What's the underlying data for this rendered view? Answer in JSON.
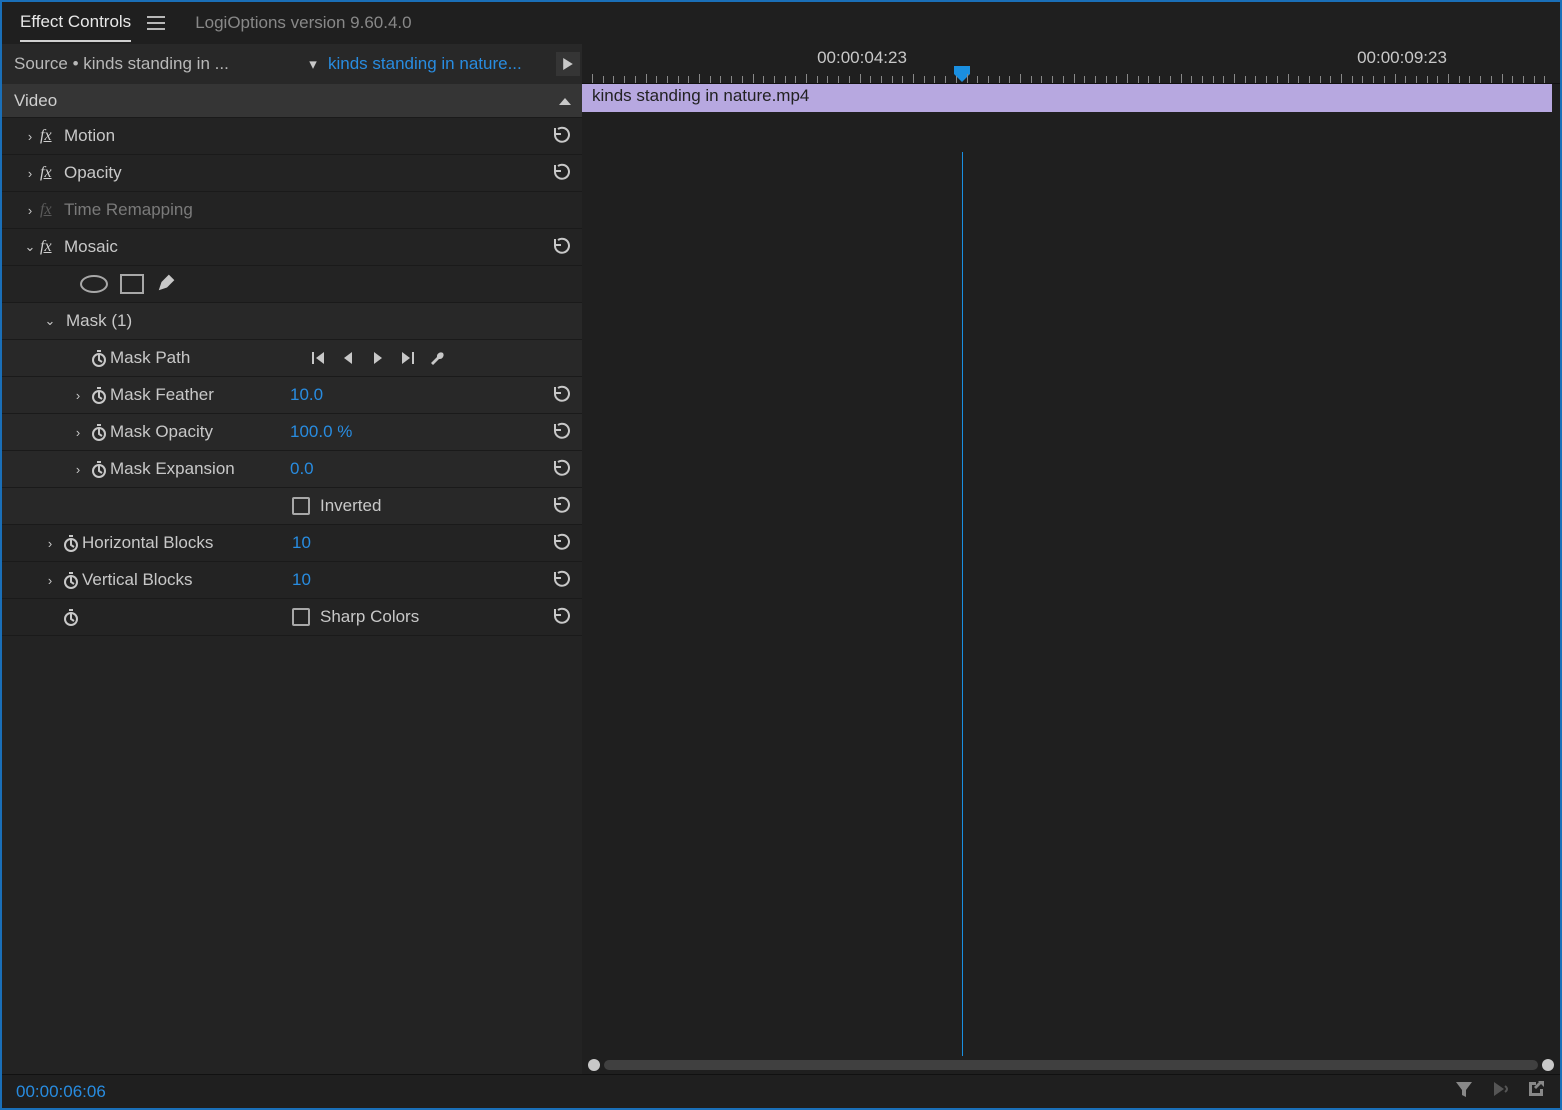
{
  "header": {
    "tab_label": "Effect Controls",
    "version_text": "LogiOptions version 9.60.4.0"
  },
  "source_row": {
    "source_label": "Source • kinds standing in ...",
    "sequence_label": "kinds standing in nature..."
  },
  "section": {
    "title": "Video"
  },
  "effects": {
    "motion": "Motion",
    "opacity": "Opacity",
    "time_remapping": "Time Remapping",
    "mosaic": "Mosaic"
  },
  "mask": {
    "title": "Mask (1)",
    "path_label": "Mask Path",
    "feather_label": "Mask Feather",
    "feather_value": "10.0",
    "opacity_label": "Mask Opacity",
    "opacity_value": "100.0 %",
    "expansion_label": "Mask Expansion",
    "expansion_value": "0.0",
    "inverted_label": "Inverted"
  },
  "mosaic_props": {
    "hblocks_label": "Horizontal Blocks",
    "hblocks_value": "10",
    "vblocks_label": "Vertical Blocks",
    "vblocks_value": "10",
    "sharp_label": "Sharp Colors"
  },
  "timeline": {
    "label_1": "00:00:04:23",
    "label_2": "00:00:09:23",
    "clip_name": "kinds standing in nature.mp4"
  },
  "footer": {
    "timecode": "00:00:06:06"
  }
}
